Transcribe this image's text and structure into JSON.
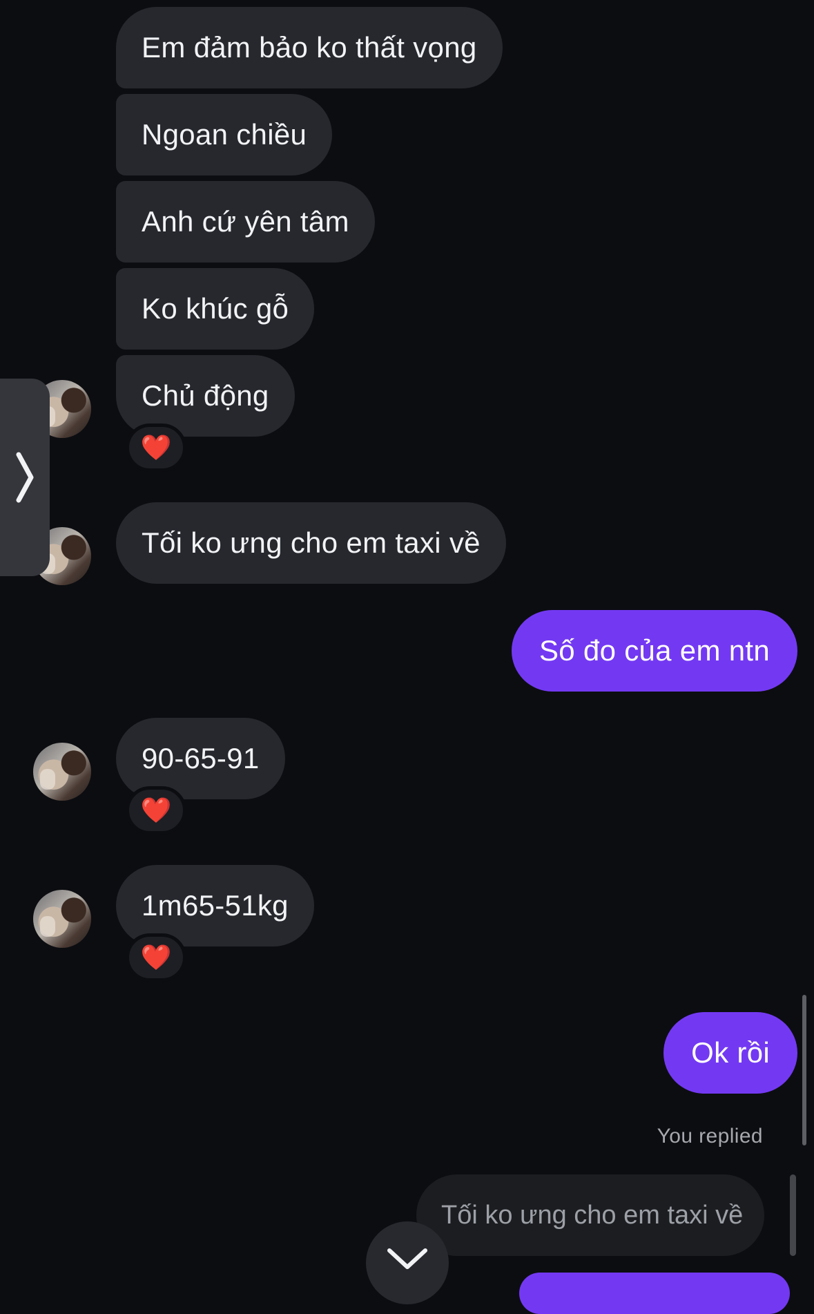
{
  "messages": {
    "m1": "Em đảm bảo ko thất vọng",
    "m2": "Ngoan chiều",
    "m3": "Anh cứ yên tâm",
    "m4": "Ko khúc gỗ",
    "m5": "Chủ động",
    "m6": "Tối ko ưng cho em taxi về",
    "m7": "Số đo của em ntn",
    "m8": "90-65-91",
    "m9": "1m65-51kg",
    "m10": "Ok rồi"
  },
  "reactions": {
    "heart": "❤️"
  },
  "reply": {
    "label": "You replied",
    "quoted_text": "Tối ko ưng cho em taxi về"
  },
  "colors": {
    "background": "#0c0d11",
    "incoming_bubble": "#26282e",
    "outgoing_bubble": "#7339f2"
  },
  "icons": {
    "side_handle": "chevron-right-icon",
    "scroll_down": "chevron-down-icon"
  }
}
